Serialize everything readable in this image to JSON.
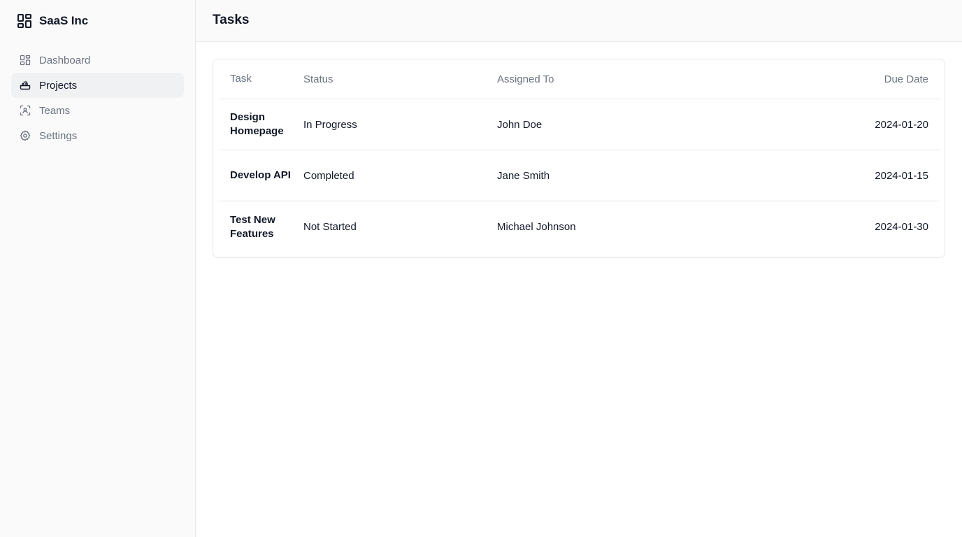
{
  "sidebar": {
    "brand": {
      "name": "SaaS Inc",
      "icon": "app-grid-icon"
    },
    "items": [
      {
        "label": "Dashboard",
        "icon": "dashboard-grid-icon",
        "active": false
      },
      {
        "label": "Projects",
        "icon": "projects-icon",
        "active": true
      },
      {
        "label": "Teams",
        "icon": "teams-icon",
        "active": false
      },
      {
        "label": "Settings",
        "icon": "gear-icon",
        "active": false
      }
    ]
  },
  "header": {
    "title": "Tasks"
  },
  "table": {
    "columns": [
      "Task",
      "Status",
      "Assigned To",
      "Due Date"
    ],
    "rows": [
      {
        "task": "Design Homepage",
        "status": "In Progress",
        "assigned": "John Doe",
        "due": "2024-01-20"
      },
      {
        "task": "Develop API",
        "status": "Completed",
        "assigned": "Jane Smith",
        "due": "2024-01-15"
      },
      {
        "task": "Test New Features",
        "status": "Not Started",
        "assigned": "Michael Johnson",
        "due": "2024-01-30"
      }
    ]
  },
  "colors": {
    "sidebar_bg": "#fafafa",
    "active_item_bg": "#f0f1f3",
    "border": "#e5e7eb",
    "muted_text": "#6b7280",
    "text": "#111827"
  }
}
